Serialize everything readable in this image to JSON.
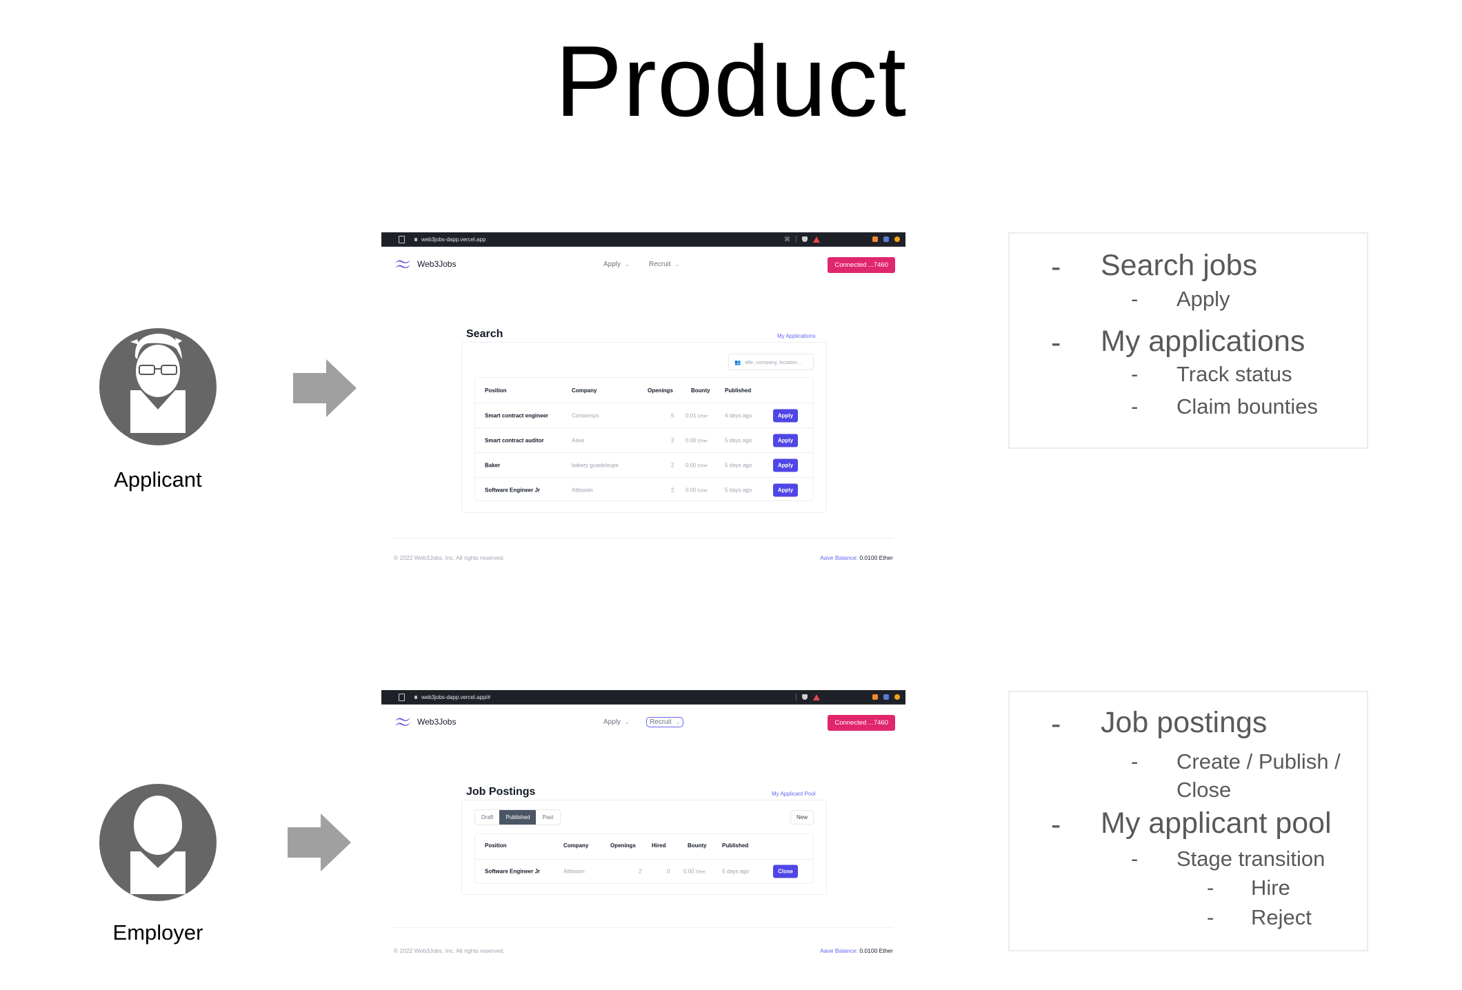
{
  "slide_title": "Product",
  "roles": {
    "applicant": {
      "label": "Applicant"
    },
    "employer": {
      "label": "Employer"
    }
  },
  "applicant_screen": {
    "url": "web3jobs-dapp.vercel.app",
    "brand": "Web3Jobs",
    "nav": {
      "apply": "Apply",
      "recruit": "Recruit",
      "chevron": "⌄"
    },
    "connect_button": "Connected ...7460",
    "page_title": "Search",
    "top_link": "My Applications",
    "search_placeholder": "title, company, location...",
    "columns": [
      "Position",
      "Company",
      "Openings",
      "Bounty",
      "Published"
    ],
    "rows": [
      {
        "position": "Smart contract engineer",
        "company": "Consensys",
        "openings": "5",
        "bounty": "0.01",
        "unit": "Ether",
        "published": "4 days ago",
        "action": "Apply"
      },
      {
        "position": "Smart contract auditor",
        "company": "Aave",
        "openings": "2",
        "bounty": "0.00",
        "unit": "Ether",
        "published": "5 days ago",
        "action": "Apply"
      },
      {
        "position": "Baker",
        "company": "bakery guadeloupe",
        "openings": "2",
        "bounty": "0.00",
        "unit": "Ether",
        "published": "5 days ago",
        "action": "Apply"
      },
      {
        "position": "Software Engineer Jr",
        "company": "Attlasian",
        "openings": "2",
        "bounty": "0.00",
        "unit": "Ether",
        "published": "5 days ago",
        "action": "Apply"
      }
    ],
    "footer": {
      "copyright": "© 2022 Web3Jobs, Inc. All rights reserved.",
      "balance_label": "Aave Balance:",
      "balance_value": "0.0100 Ether"
    }
  },
  "employer_screen": {
    "url": "web3jobs-dapp.vercel.app/#",
    "brand": "Web3Jobs",
    "nav": {
      "apply": "Apply",
      "recruit": "Recruit",
      "chevron": "⌄"
    },
    "connect_button": "Connected ...7460",
    "page_title": "Job Postings",
    "top_link": "My Applicant Pool",
    "tabs": [
      "Draft",
      "Published",
      "Past"
    ],
    "active_tab": "Published",
    "new_button": "New",
    "columns": [
      "Position",
      "Company",
      "Openings",
      "Hired",
      "Bounty",
      "Published"
    ],
    "rows": [
      {
        "position": "Software Engineer Jr",
        "company": "Attlasian",
        "openings": "2",
        "hired": "0",
        "bounty": "0.00",
        "unit": "Ether",
        "published": "5 days ago",
        "action": "Close"
      }
    ],
    "footer": {
      "copyright": "© 2022 Web3Jobs, Inc. All rights reserved.",
      "balance_label": "Aave Balance:",
      "balance_value": "0.0100 Ether"
    }
  },
  "applicant_features": {
    "bullet": "-",
    "items": [
      {
        "text": "Search jobs",
        "level": 1
      },
      {
        "text": "Apply",
        "level": 2
      },
      {
        "text": "My applications",
        "level": 1
      },
      {
        "text": "Track status",
        "level": 2
      },
      {
        "text": "Claim bounties",
        "level": 2
      }
    ]
  },
  "employer_features": {
    "bullet": "-",
    "items": [
      {
        "text": "Job postings",
        "level": 1
      },
      {
        "text": "Create / Publish /",
        "level": 2
      },
      {
        "text": "Close",
        "level": 2
      },
      {
        "text": "My applicant pool",
        "level": 1
      },
      {
        "text": "Stage transition",
        "level": 2
      },
      {
        "text": "Hire",
        "level": 3
      },
      {
        "text": "Reject",
        "level": 3
      }
    ]
  },
  "colors": {
    "accent": "#4f46e5",
    "connect": "#e0266d",
    "avatar": "#666666",
    "arrow": "#a0a0a0"
  }
}
